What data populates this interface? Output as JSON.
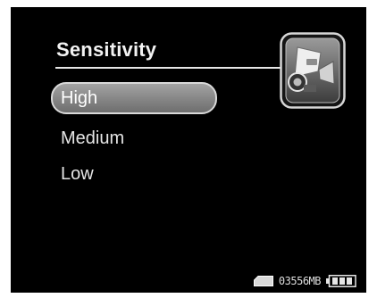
{
  "menu": {
    "title": "Sensitivity",
    "options": [
      {
        "label": "High",
        "selected": true
      },
      {
        "label": "Medium",
        "selected": false
      },
      {
        "label": "Low",
        "selected": false
      }
    ]
  },
  "mode_icon": "video-camera-icon",
  "status": {
    "storage_icon": "memory-card-icon",
    "free_space": "03556MB",
    "battery_icon": "battery-full-icon",
    "battery_level": 1.0
  },
  "colors": {
    "background": "#000000",
    "text": "#e6e6e6",
    "highlight": "#8c8c8c"
  }
}
